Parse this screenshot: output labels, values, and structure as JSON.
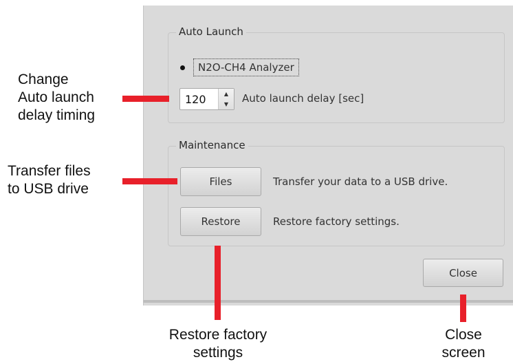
{
  "auto_launch": {
    "title": "Auto Launch",
    "analyzer_option": "N2O-CH4 Analyzer",
    "delay_value": "120",
    "delay_label": "Auto launch delay [sec]"
  },
  "maintenance": {
    "title": "Maintenance",
    "files_button": "Files",
    "files_desc": "Transfer your data to a USB drive.",
    "restore_button": "Restore",
    "restore_desc": "Restore factory settings."
  },
  "close_button": "Close",
  "annotations": {
    "delay": [
      "Change",
      "Auto launch",
      "delay timing"
    ],
    "transfer": [
      "Transfer files",
      "to USB drive"
    ],
    "restore": [
      "Restore factory",
      "settings"
    ],
    "close": [
      "Close",
      "screen"
    ]
  },
  "colors": {
    "annotation_bar": "#e8202a",
    "dialog_bg": "#dadada"
  },
  "icons": {
    "spin_up": "▲",
    "spin_down": "▼"
  }
}
